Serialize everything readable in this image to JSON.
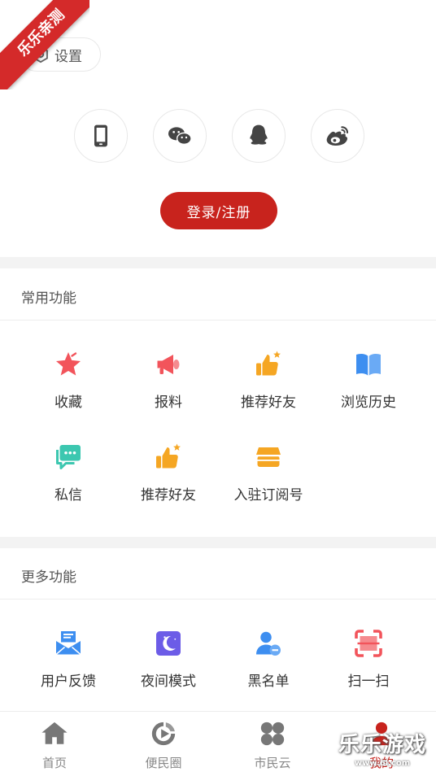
{
  "ribbon": {
    "text": "乐乐亲测"
  },
  "settings": {
    "label": "设置"
  },
  "login": {
    "methods": [
      {
        "icon": "phone-icon"
      },
      {
        "icon": "wechat-icon"
      },
      {
        "icon": "qq-icon"
      },
      {
        "icon": "weibo-icon"
      }
    ],
    "button_label": "登录/注册"
  },
  "common": {
    "title": "常用功能",
    "items": [
      {
        "label": "收藏",
        "icon": "star-icon"
      },
      {
        "label": "报料",
        "icon": "megaphone-icon"
      },
      {
        "label": "推荐好友",
        "icon": "thumbs-up-icon"
      },
      {
        "label": "浏览历史",
        "icon": "book-icon"
      },
      {
        "label": "私信",
        "icon": "message-icon"
      },
      {
        "label": "推荐好友",
        "icon": "thumbs-up-icon"
      },
      {
        "label": "入驻订阅号",
        "icon": "store-icon"
      }
    ]
  },
  "more": {
    "title": "更多功能",
    "items": [
      {
        "label": "用户反馈",
        "icon": "feedback-mail-icon"
      },
      {
        "label": "夜间模式",
        "icon": "moon-icon"
      },
      {
        "label": "黑名单",
        "icon": "user-block-icon"
      },
      {
        "label": "扫一扫",
        "icon": "scan-icon"
      }
    ]
  },
  "tabbar": {
    "tabs": [
      {
        "label": "首页",
        "icon": "home-icon"
      },
      {
        "label": "便民圈",
        "icon": "circle-play-icon"
      },
      {
        "label": "市民云",
        "icon": "clover-icon"
      },
      {
        "label": "我的",
        "icon": "user-icon"
      }
    ],
    "active_index": 3
  },
  "watermark": {
    "line1": "乐乐游戏",
    "line2": "www.6l.com"
  },
  "colors": {
    "accent": "#c8231d",
    "star": "#f2545b",
    "megaphone": "#f2545b",
    "orange": "#f5a623",
    "blue": "#3d8ef0",
    "teal": "#3cc7b0",
    "purple": "#6c5ce7"
  }
}
